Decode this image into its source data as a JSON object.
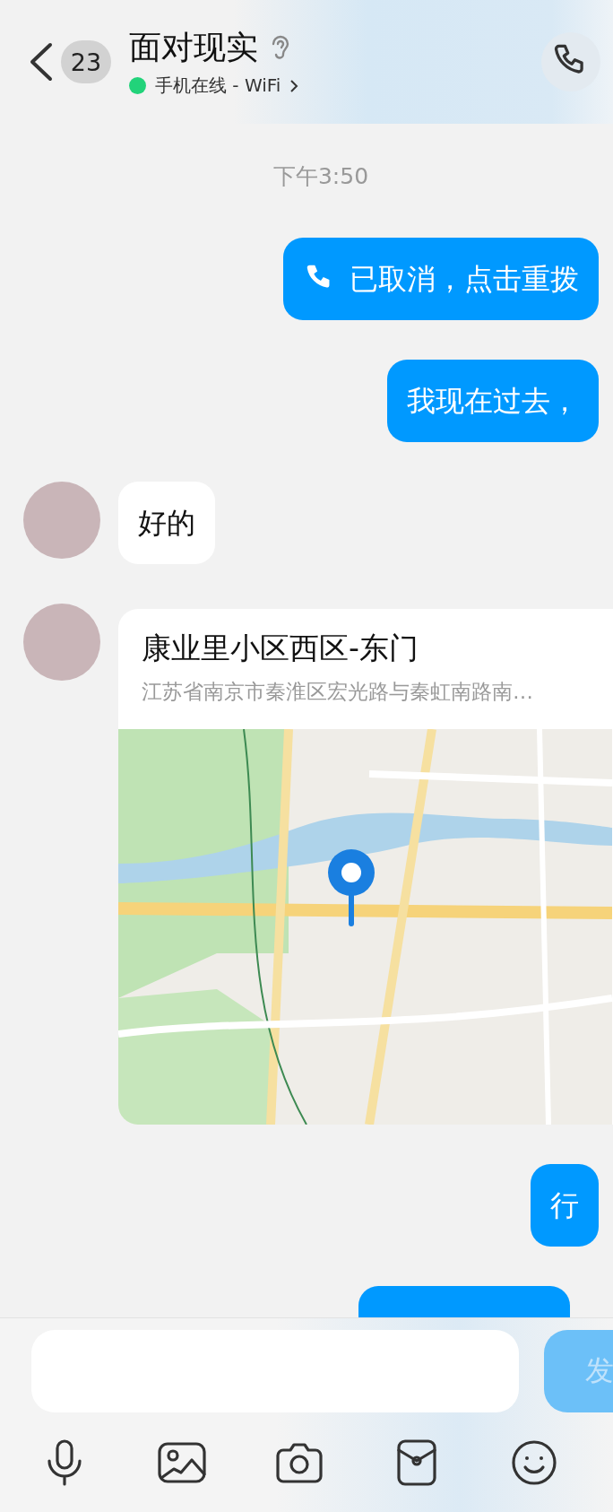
{
  "header": {
    "unread_count": "23",
    "title": "面对现实",
    "status_text": "手机在线 - WiFi"
  },
  "messages": [
    {
      "kind": "time",
      "text": "下午3:50"
    },
    {
      "kind": "call",
      "sent": true,
      "text": "已取消，点击重拨"
    },
    {
      "kind": "text",
      "sent": true,
      "text": "我现在过去，"
    },
    {
      "kind": "text",
      "sent": false,
      "text": "好的"
    },
    {
      "kind": "location",
      "sent": false,
      "title": "康业里小区西区-东门",
      "address": "江苏省南京市秦淮区宏光路与秦虹南路南…"
    },
    {
      "kind": "text",
      "sent": true,
      "text": "行"
    },
    {
      "kind": "partial",
      "sent": true
    }
  ],
  "composer": {
    "send_label": "发"
  }
}
